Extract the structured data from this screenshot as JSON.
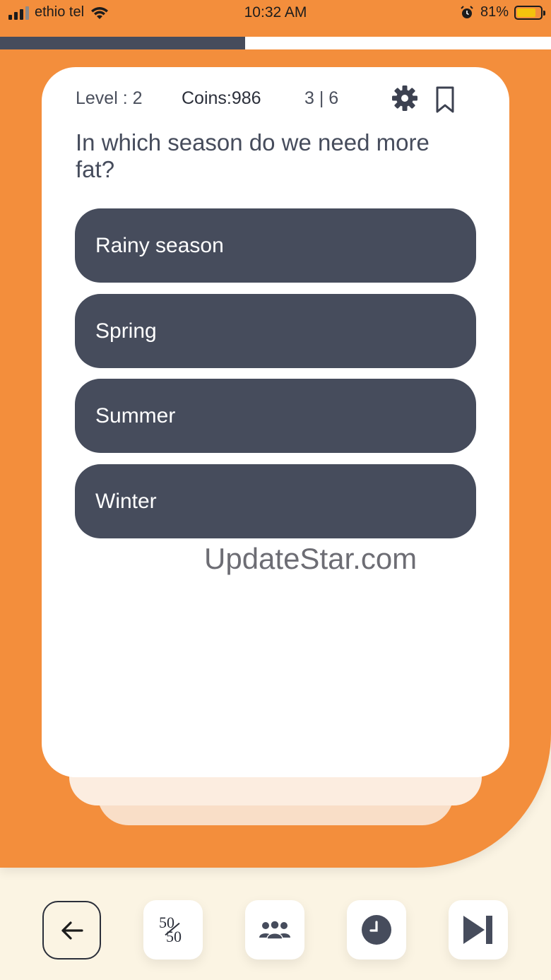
{
  "status_bar": {
    "carrier": "ethio tel",
    "time": "10:32 AM",
    "battery_percent": "81%",
    "battery_level": 0.81,
    "icons": [
      "signal-icon",
      "wifi-icon",
      "alarm-icon",
      "battery-icon"
    ]
  },
  "progress": {
    "fraction": 0.445,
    "fill_color": "#464C5C",
    "track_color": "#FFFFFF"
  },
  "quiz": {
    "level": "Level : 2",
    "coins": "Coins:986",
    "question_count": "3 | 6",
    "question": "In which season do we need more fat?",
    "options": [
      "Rainy season",
      "Spring",
      "Summer",
      "Winter"
    ]
  },
  "watermark": "UpdateStar.com",
  "toolbar": {
    "buttons": [
      {
        "name": "back",
        "icon": "arrow-left-icon"
      },
      {
        "name": "fifty-fifty",
        "icon": "fifty-fifty-icon",
        "glyph_top": "50",
        "glyph_bottom": "50"
      },
      {
        "name": "audience-poll",
        "icon": "people-icon"
      },
      {
        "name": "timer",
        "icon": "clock-icon"
      },
      {
        "name": "skip",
        "icon": "skip-next-icon"
      }
    ]
  },
  "colors": {
    "accent": "#F38E3C",
    "dark": "#464C5C",
    "background": "#FBF4E3",
    "card": "#FFFFFF",
    "battery": "#F4C20D"
  }
}
